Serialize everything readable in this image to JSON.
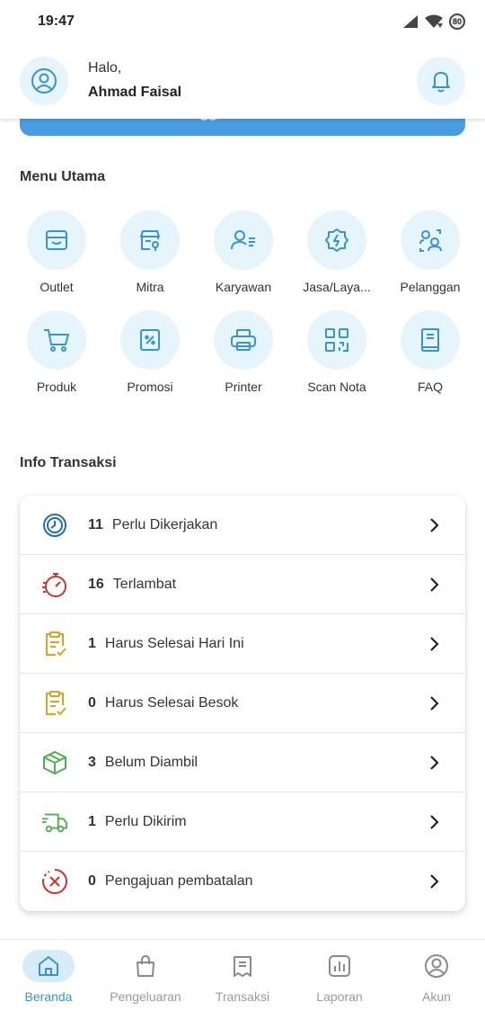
{
  "status_bar": {
    "time": "19:47",
    "battery": "80"
  },
  "header": {
    "greeting": "Halo,",
    "user_name": "Ahmad Faisal"
  },
  "menu": {
    "title": "Menu Utama",
    "items": [
      {
        "label": "Outlet",
        "icon": "store-icon"
      },
      {
        "label": "Mitra",
        "icon": "partner-store-icon"
      },
      {
        "label": "Karyawan",
        "icon": "employee-icon"
      },
      {
        "label": "Jasa/Laya...",
        "icon": "service-badge-icon"
      },
      {
        "label": "Pelanggan",
        "icon": "customers-icon"
      },
      {
        "label": "Produk",
        "icon": "cart-icon"
      },
      {
        "label": "Promosi",
        "icon": "promo-icon"
      },
      {
        "label": "Printer",
        "icon": "printer-icon"
      },
      {
        "label": "Scan Nota",
        "icon": "qr-code-icon"
      },
      {
        "label": "FAQ",
        "icon": "book-icon"
      }
    ]
  },
  "info": {
    "title": "Info Transaksi",
    "rows": [
      {
        "count": "11",
        "label": "Perlu Dikerjakan",
        "icon": "clock-icon",
        "color": "#1f6fa8"
      },
      {
        "count": "16",
        "label": "Terlambat",
        "icon": "stopwatch-icon",
        "color": "#c0392b"
      },
      {
        "count": "1",
        "label": "Harus Selesai Hari Ini",
        "icon": "clipboard-check-icon",
        "color": "#e0a020"
      },
      {
        "count": "0",
        "label": "Harus Selesai Besok",
        "icon": "clipboard-check-icon",
        "color": "#e0a020"
      },
      {
        "count": "3",
        "label": "Belum Diambil",
        "icon": "package-icon",
        "color": "#4caf50"
      },
      {
        "count": "1",
        "label": "Perlu Dikirim",
        "icon": "truck-icon",
        "color": "#4caf50"
      },
      {
        "count": "0",
        "label": "Pengajuan pembatalan",
        "icon": "cancel-circle-icon",
        "color": "#d32f2f"
      }
    ]
  },
  "bottom_nav": {
    "items": [
      {
        "label": "Beranda",
        "icon": "home-icon",
        "active": true
      },
      {
        "label": "Pengeluaran",
        "icon": "shopping-bag-icon",
        "active": false
      },
      {
        "label": "Transaksi",
        "icon": "receipt-icon",
        "active": false
      },
      {
        "label": "Laporan",
        "icon": "report-chart-icon",
        "active": false
      },
      {
        "label": "Akun",
        "icon": "account-icon",
        "active": false
      }
    ]
  },
  "colors": {
    "accent": "#3593d6",
    "banner": "#4a9de0",
    "icon_bg": "#e6f4fb"
  }
}
